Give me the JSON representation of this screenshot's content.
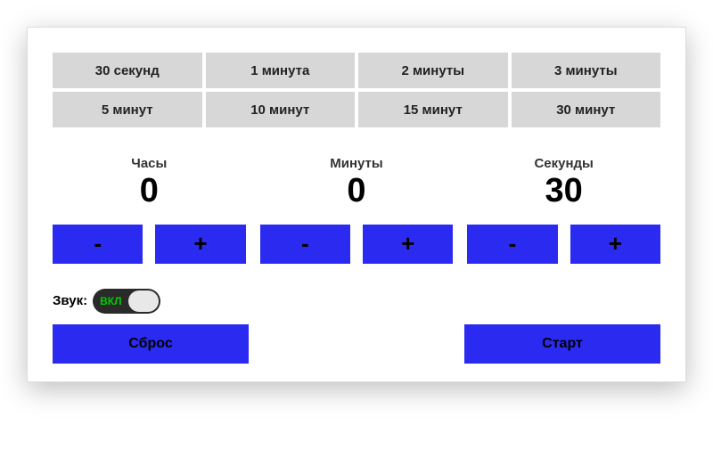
{
  "presets": [
    {
      "label": "30 секунд"
    },
    {
      "label": "1 минута"
    },
    {
      "label": "2 минуты"
    },
    {
      "label": "3 минуты"
    },
    {
      "label": "5 минут"
    },
    {
      "label": "10 минут"
    },
    {
      "label": "15 минут"
    },
    {
      "label": "30 минут"
    }
  ],
  "units": {
    "hours": {
      "label": "Часы",
      "value": "0"
    },
    "minutes": {
      "label": "Минуты",
      "value": "0"
    },
    "seconds": {
      "label": "Секунды",
      "value": "30"
    }
  },
  "glyph": {
    "minus": "-",
    "plus": "+"
  },
  "sound": {
    "label": "Звук:",
    "state": "ВКЛ"
  },
  "actions": {
    "reset": "Сброс",
    "start": "Старт"
  }
}
